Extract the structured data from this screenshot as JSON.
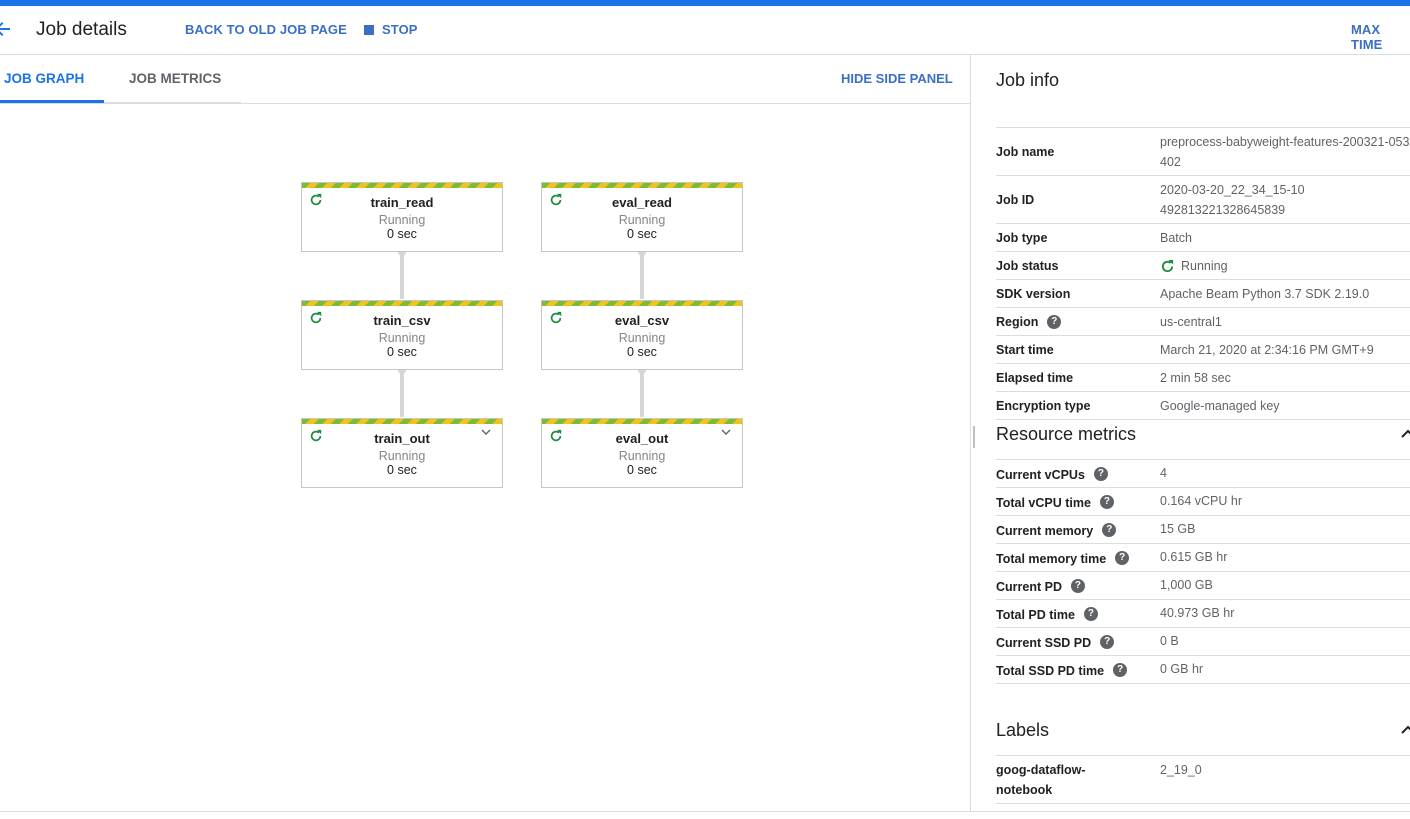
{
  "header": {
    "title": "Job details",
    "back_old_label": "BACK TO OLD JOB PAGE",
    "stop_label": "STOP",
    "max_time_label": "MAX TIME"
  },
  "tabs": [
    {
      "label": "JOB GRAPH",
      "active": true
    },
    {
      "label": "JOB METRICS",
      "active": false
    }
  ],
  "hide_panel_label": "HIDE SIDE PANEL",
  "graph": {
    "nodes": [
      {
        "name": "train_read",
        "state": "Running",
        "duration": "0 sec"
      },
      {
        "name": "eval_read",
        "state": "Running",
        "duration": "0 sec"
      },
      {
        "name": "train_csv",
        "state": "Running",
        "duration": "0 sec"
      },
      {
        "name": "eval_csv",
        "state": "Running",
        "duration": "0 sec"
      },
      {
        "name": "train_out",
        "state": "Running",
        "duration": "0 sec"
      },
      {
        "name": "eval_out",
        "state": "Running",
        "duration": "0 sec"
      }
    ]
  },
  "job_info": {
    "title": "Job info",
    "rows": [
      {
        "key": "Job name",
        "value": "preprocess-babyweight-features-200321-053402"
      },
      {
        "key": "Job ID",
        "value": "2020-03-20_22_34_15-10492813221328645839"
      },
      {
        "key": "Job type",
        "value": "Batch"
      },
      {
        "key": "Job status",
        "value": "Running"
      },
      {
        "key": "SDK version",
        "value": "Apache Beam Python 3.7 SDK 2.19.0"
      },
      {
        "key": "Region",
        "value": "us-central1"
      },
      {
        "key": "Start time",
        "value": "March 21, 2020 at 2:34:16 PM GMT+9"
      },
      {
        "key": "Elapsed time",
        "value": "2 min 58 sec"
      },
      {
        "key": "Encryption type",
        "value": "Google-managed key"
      }
    ]
  },
  "resource_metrics": {
    "title": "Resource metrics",
    "rows": [
      {
        "key": "Current vCPUs",
        "value": "4"
      },
      {
        "key": "Total vCPU time",
        "value": "0.164 vCPU hr"
      },
      {
        "key": "Current memory",
        "value": "15 GB"
      },
      {
        "key": "Total memory time",
        "value": "0.615 GB hr"
      },
      {
        "key": "Current PD",
        "value": "1,000 GB"
      },
      {
        "key": "Total PD time",
        "value": "40.973 GB hr"
      },
      {
        "key": "Current SSD PD",
        "value": "0 B"
      },
      {
        "key": "Total SSD PD time",
        "value": "0 GB hr"
      }
    ]
  },
  "labels": {
    "title": "Labels",
    "rows": [
      {
        "key": "goog-dataflow-notebook",
        "value": "2_19_0"
      }
    ]
  },
  "colors": {
    "accent": "#1a73e8",
    "running_green": "#1e8e3e",
    "stripe_green": "#7cbb3a",
    "stripe_yellow": "#f2c31a"
  },
  "icons": {
    "back": "arrow-left-icon",
    "stop": "stop-square-icon",
    "running": "refresh-running-icon",
    "help": "help-circle-icon",
    "collapse": "chevron-up-icon",
    "expand": "chevron-down-icon"
  }
}
